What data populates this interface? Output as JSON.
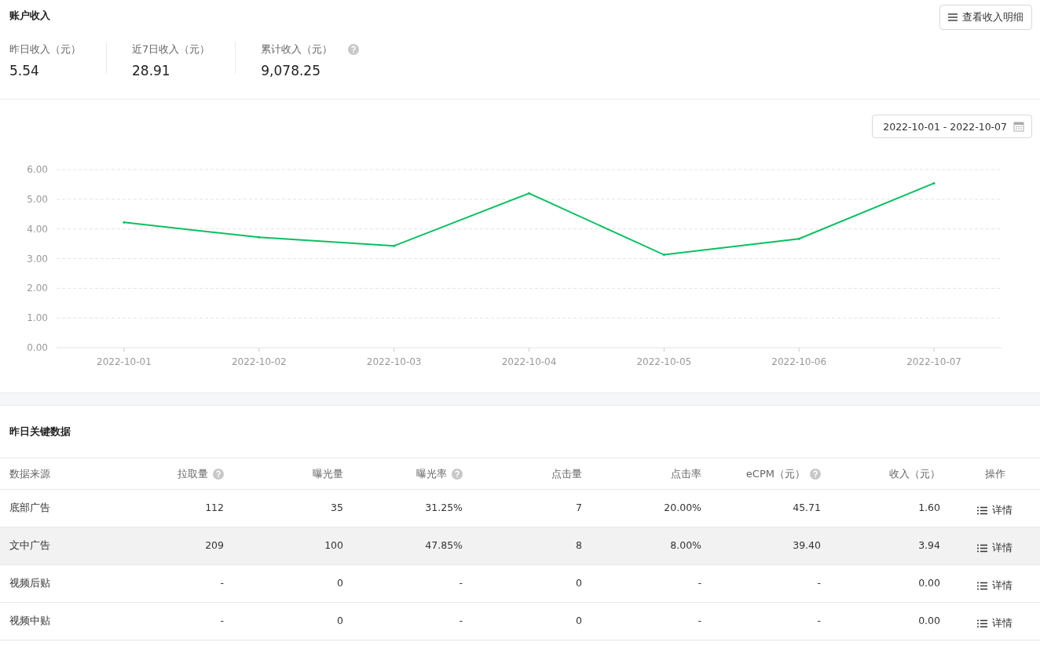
{
  "account": {
    "title": "账户收入",
    "detail_button": "查看收入明细",
    "stats": [
      {
        "label": "昨日收入（元）",
        "value": "5.54",
        "help": false
      },
      {
        "label": "近7日收入（元）",
        "value": "28.91",
        "help": false
      },
      {
        "label": "累计收入（元）",
        "value": "9,078.25",
        "help": true
      }
    ]
  },
  "trend": {
    "date_range": "2022-10-01 - 2022-10-07",
    "chart_data": {
      "type": "line",
      "categories": [
        "2022-10-01",
        "2022-10-02",
        "2022-10-03",
        "2022-10-04",
        "2022-10-05",
        "2022-10-06",
        "2022-10-07"
      ],
      "grid": true,
      "series": [
        {
          "color": "#07c160",
          "values": [
            4.22,
            3.72,
            3.43,
            5.2,
            3.13,
            3.67,
            5.54
          ]
        }
      ],
      "ylim": [
        0,
        6
      ],
      "yticks": [
        {
          "value": 0,
          "label": "0.00"
        },
        {
          "value": 1,
          "label": "1.00"
        },
        {
          "value": 2,
          "label": "2.00"
        },
        {
          "value": 3,
          "label": "3.00"
        },
        {
          "value": 4,
          "label": "4.00"
        },
        {
          "value": 5,
          "label": "5.00"
        },
        {
          "value": 6,
          "label": "6.00"
        }
      ]
    }
  },
  "key_data": {
    "title": "昨日关键数据",
    "columns": [
      {
        "label": "数据来源",
        "help": false
      },
      {
        "label": "拉取量",
        "help": true
      },
      {
        "label": "曝光量",
        "help": false
      },
      {
        "label": "曝光率",
        "help": true
      },
      {
        "label": "点击量",
        "help": false
      },
      {
        "label": "点击率",
        "help": false
      },
      {
        "label": "eCPM（元）",
        "help": true
      },
      {
        "label": "收入（元）",
        "help": false
      },
      {
        "label": "操作",
        "help": false
      }
    ],
    "rows": [
      {
        "cells": [
          "底部广告",
          "112",
          "35",
          "31.25%",
          "7",
          "20.00%",
          "45.71",
          "1.60"
        ],
        "action": "详情",
        "highlighted": false
      },
      {
        "cells": [
          "文中广告",
          "209",
          "100",
          "47.85%",
          "8",
          "8.00%",
          "39.40",
          "3.94"
        ],
        "action": "详情",
        "highlighted": true
      },
      {
        "cells": [
          "视频后贴",
          "-",
          "0",
          "-",
          "0",
          "-",
          "-",
          "0.00"
        ],
        "action": "详情",
        "highlighted": false
      },
      {
        "cells": [
          "视频中贴",
          "-",
          "0",
          "-",
          "0",
          "-",
          "-",
          "0.00"
        ],
        "action": "详情",
        "highlighted": false
      }
    ]
  }
}
